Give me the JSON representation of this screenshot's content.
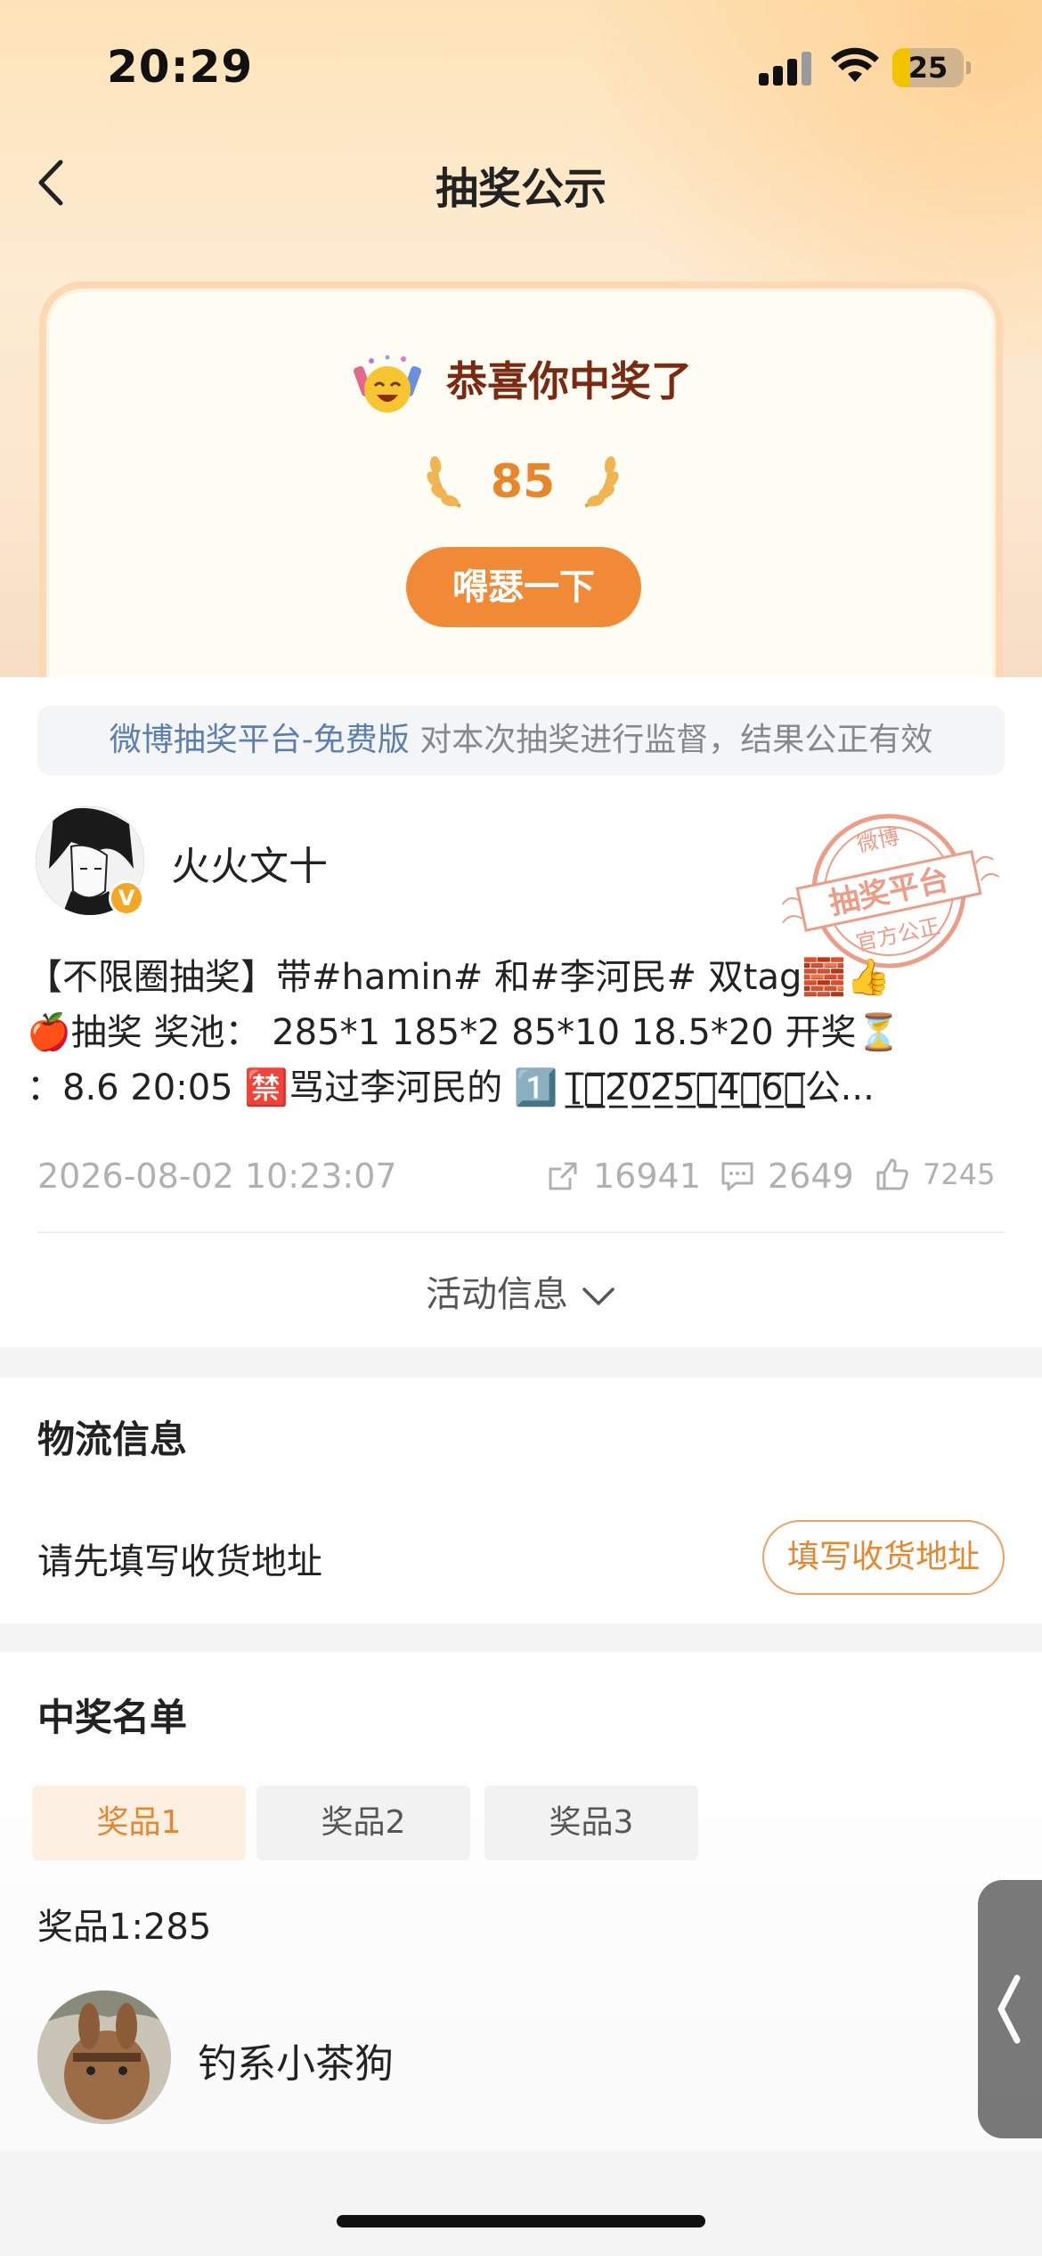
{
  "status_bar": {
    "time": "20:29",
    "battery": "25",
    "battery_percent": 25
  },
  "nav": {
    "title": "抽奖公示"
  },
  "prize_card": {
    "congrats": "恭喜你中奖了",
    "amount": "85",
    "action_button": "嘚瑟一下"
  },
  "platform_banner": {
    "link_text": "微博抽奖平台-免费版",
    "text": "对本次抽奖进行监督，结果公正有效"
  },
  "post": {
    "username": "火火文十",
    "stamp_lines": [
      "微博",
      "抽奖平台",
      "官方公正"
    ],
    "lines": [
      "【不限圈抽奖】带#hamin# 和#李河民# 双tag🧱👍",
      "🍎抽奖 奖池： 285*1 185*2 85*10 18.5*20 开奖⏳",
      "：8.6 20:05 🈲骂过李河民的 1️⃣ [̲̅自̲̅2̲̅0̲̅2̲̅5̲̅年̲̅4̲̅月̲̅6̲̅日̲̅公..."
    ],
    "datetime": "2026-08-02 10:23:07",
    "reposts": "16941",
    "comments": "2649",
    "likes": "7245",
    "activity_info": "活动信息"
  },
  "logistics": {
    "title": "物流信息",
    "hint": "请先填写收货地址",
    "button": "填写收货地址"
  },
  "winners": {
    "title": "中奖名单",
    "tabs": [
      {
        "label": "奖品1",
        "active": true
      },
      {
        "label": "奖品2",
        "active": false
      },
      {
        "label": "奖品3",
        "active": false
      }
    ],
    "prize_label": "奖品1:285",
    "winner_name": "钓系小茶狗"
  },
  "colors": {
    "accent": "#f08a36",
    "accent_text": "#e8862d",
    "link": "#5b7fb0",
    "congrats_text": "#7a2a10"
  },
  "icons": [
    "back-icon",
    "signal-icon",
    "wifi-icon",
    "battery-icon",
    "party-emoji-icon",
    "laurel-icon",
    "verified-badge-icon",
    "repost-icon",
    "comment-icon",
    "like-icon",
    "chevron-down-icon",
    "chevron-left-icon"
  ]
}
